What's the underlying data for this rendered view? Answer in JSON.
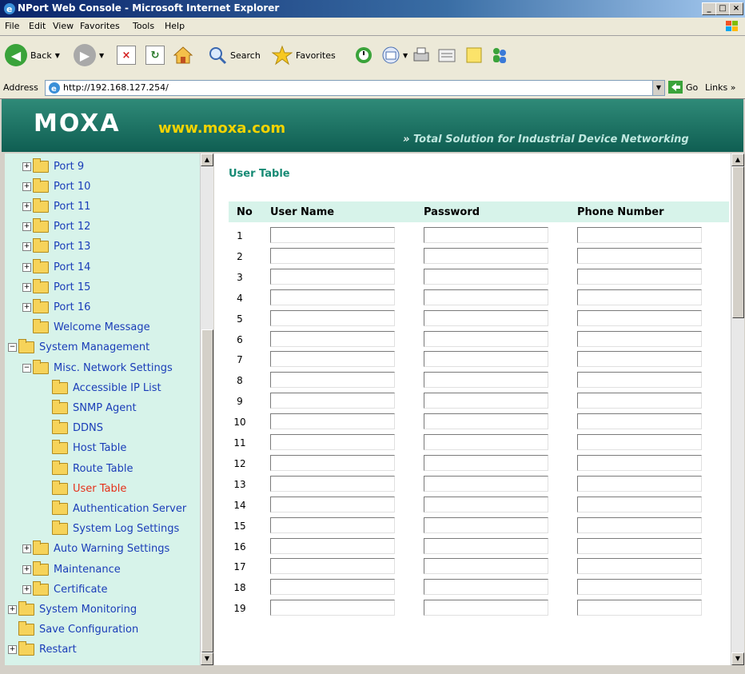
{
  "window": {
    "title": "NPort Web Console - Microsoft Internet Explorer"
  },
  "menu": [
    "File",
    "Edit",
    "View",
    "Favorites",
    "Tools",
    "Help"
  ],
  "toolbar": {
    "back": "Back",
    "search": "Search",
    "favorites": "Favorites"
  },
  "address": {
    "label": "Address",
    "url": "http://192.168.127.254/",
    "go": "Go",
    "links": "Links"
  },
  "banner": {
    "logo": "MOXA",
    "site": "www.moxa.com",
    "slogan": "Total Solution for Industrial Device Networking"
  },
  "tree": [
    {
      "label": "Port 9",
      "expand": "+"
    },
    {
      "label": "Port 10",
      "expand": "+"
    },
    {
      "label": "Port 11",
      "expand": "+"
    },
    {
      "label": "Port 12",
      "expand": "+"
    },
    {
      "label": "Port 13",
      "expand": "+"
    },
    {
      "label": "Port 14",
      "expand": "+"
    },
    {
      "label": "Port 15",
      "expand": "+"
    },
    {
      "label": "Port 16",
      "expand": "+"
    },
    {
      "label": "Welcome Message",
      "expand": ""
    },
    {
      "label": "System Management",
      "expand": "−"
    },
    {
      "label": "Misc. Network Settings",
      "expand": "−"
    },
    {
      "label": "Accessible IP List",
      "expand": ""
    },
    {
      "label": "SNMP Agent",
      "expand": ""
    },
    {
      "label": "DDNS",
      "expand": ""
    },
    {
      "label": "Host Table",
      "expand": ""
    },
    {
      "label": "Route Table",
      "expand": ""
    },
    {
      "label": "User Table",
      "expand": "",
      "active": true
    },
    {
      "label": "Authentication Server",
      "expand": ""
    },
    {
      "label": "System Log Settings",
      "expand": ""
    },
    {
      "label": "Auto Warning Settings",
      "expand": "+"
    },
    {
      "label": "Maintenance",
      "expand": "+"
    },
    {
      "label": "Certificate",
      "expand": "+"
    },
    {
      "label": "System Monitoring",
      "expand": "+"
    },
    {
      "label": "Save Configuration",
      "expand": ""
    },
    {
      "label": "Restart",
      "expand": "+"
    }
  ],
  "main": {
    "title": "User Table",
    "columns": [
      "No",
      "User Name",
      "Password",
      "Phone Number"
    ],
    "rows": [
      "1",
      "2",
      "3",
      "4",
      "5",
      "6",
      "7",
      "8",
      "9",
      "10",
      "11",
      "12",
      "13",
      "14",
      "15",
      "16",
      "17",
      "18",
      "19"
    ]
  }
}
